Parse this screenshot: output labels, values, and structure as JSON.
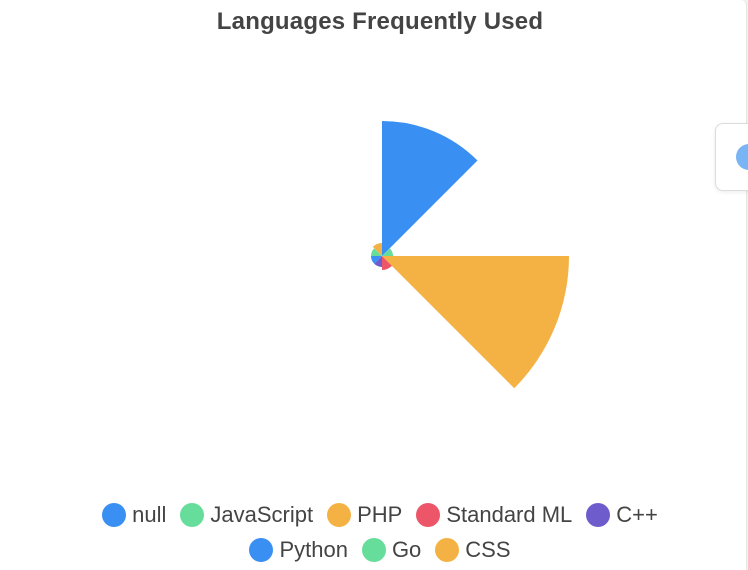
{
  "chart_data": {
    "type": "polarArea",
    "title": "Languages Frequently Used",
    "segments": [
      {
        "label": "null",
        "value": 135,
        "color": "#3a8ff2"
      },
      {
        "label": "JavaScript",
        "value": 11,
        "color": "#66dd9a"
      },
      {
        "label": "PHP",
        "value": 187,
        "color": "#f4b244"
      },
      {
        "label": "Standard ML",
        "value": 14,
        "color": "#ec5668"
      },
      {
        "label": "C++",
        "value": 11,
        "color": "#6e5ccc"
      },
      {
        "label": "Python",
        "value": 11,
        "color": "#3a8ff2"
      },
      {
        "label": "Go",
        "value": 11,
        "color": "#66dd9a"
      },
      {
        "label": "CSS",
        "value": 13,
        "color": "#f4b244"
      }
    ],
    "legend_position": "bottom",
    "legend_rows": [
      [
        "null",
        "JavaScript",
        "PHP",
        "Standard ML",
        "C++"
      ],
      [
        "Python",
        "Go",
        "CSS"
      ]
    ]
  },
  "tooltip": {
    "color": "#79b4f5"
  }
}
